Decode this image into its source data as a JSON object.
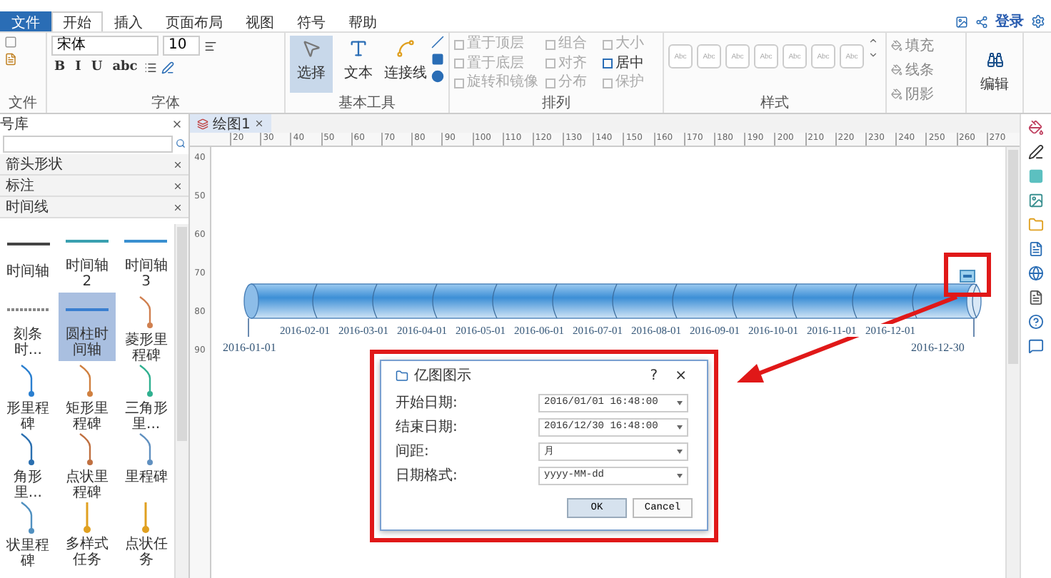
{
  "menu": [
    {
      "label": "文件",
      "kind": "file",
      "selected": false
    },
    {
      "label": "开始",
      "kind": "tab",
      "selected": true
    },
    {
      "label": "插入",
      "kind": "tab",
      "selected": false
    },
    {
      "label": "页面布局",
      "kind": "tab",
      "selected": false
    },
    {
      "label": "视图",
      "kind": "tab",
      "selected": false
    },
    {
      "label": "符号",
      "kind": "tab",
      "selected": false
    },
    {
      "label": "帮助",
      "kind": "tab",
      "selected": false
    }
  ],
  "account": {
    "login": "登录"
  },
  "ribbon": {
    "file_group": {
      "label": "文件"
    },
    "font_group": {
      "label": "字体",
      "font": "宋体",
      "size": "10",
      "buttons": [
        "B",
        "I",
        "U",
        "abc"
      ]
    },
    "tools_group": {
      "label": "基本工具",
      "tools": [
        {
          "label": "选择",
          "selected": true
        },
        {
          "label": "文本",
          "selected": false
        },
        {
          "label": "连接线",
          "selected": false
        }
      ]
    },
    "arrange_group": {
      "label": "排列",
      "items": [
        {
          "label": "置于顶层",
          "disabled": true
        },
        {
          "label": "组合",
          "disabled": true
        },
        {
          "label": "大小",
          "disabled": true
        },
        {
          "label": "置于底层",
          "disabled": true
        },
        {
          "label": "对齐",
          "disabled": true
        },
        {
          "label": "居中",
          "disabled": false
        },
        {
          "label": "旋转和镜像",
          "disabled": true
        },
        {
          "label": "分布",
          "disabled": true
        },
        {
          "label": "保护",
          "disabled": true
        }
      ]
    },
    "style_group": {
      "label": "样式",
      "samples": [
        "Abc",
        "Abc",
        "Abc",
        "Abc",
        "Abc",
        "Abc",
        "Abc"
      ]
    },
    "format_items": [
      "填充",
      "线条",
      "阴影"
    ],
    "edit": "编辑"
  },
  "library": {
    "title": "号库",
    "categories": [
      "箭头形状",
      "标注",
      "时间线"
    ],
    "shapes": [
      {
        "label": "时间轴",
        "kind": "line",
        "color": "#444444",
        "selected": false
      },
      {
        "label": "时间轴 2",
        "kind": "line",
        "color": "#3aa0b0",
        "selected": false
      },
      {
        "label": "时间轴 3",
        "kind": "line",
        "color": "#3a8fd0",
        "selected": false
      },
      {
        "label": "刻条时...",
        "kind": "dashed",
        "color": "#888888",
        "selected": false
      },
      {
        "label": "圆柱时间轴",
        "kind": "line",
        "color": "#3a7fd0",
        "selected": true
      },
      {
        "label": "菱形里程碑",
        "kind": "milestone",
        "color": "#d08050",
        "selected": false
      },
      {
        "label": "形里程碑",
        "kind": "milestone",
        "color": "#2a7fd0",
        "selected": false
      },
      {
        "label": "矩形里程碑",
        "kind": "milestone",
        "color": "#d08040",
        "selected": false
      },
      {
        "label": "三角形里...",
        "kind": "milestone",
        "color": "#30b090",
        "selected": false
      },
      {
        "label": "角形里...",
        "kind": "milestone",
        "color": "#2a6fb0",
        "selected": false
      },
      {
        "label": "点状里程碑",
        "kind": "milestone",
        "color": "#c07040",
        "selected": false
      },
      {
        "label": "里程碑",
        "kind": "milestone",
        "color": "#6090c0",
        "selected": false
      },
      {
        "label": "状里程碑",
        "kind": "milestone",
        "color": "#5090c0",
        "selected": false
      },
      {
        "label": "多样式任务",
        "kind": "task",
        "color": "#e0a020",
        "selected": false
      },
      {
        "label": "点状任务",
        "kind": "task",
        "color": "#e0a020",
        "selected": false
      }
    ]
  },
  "document_tab": {
    "label": "绘图1",
    "selected": true
  },
  "ruler": {
    "horizontal": [
      "20",
      "30",
      "40",
      "50",
      "60",
      "70",
      "80",
      "90",
      "100",
      "110",
      "120",
      "130",
      "140",
      "150",
      "160",
      "170",
      "180",
      "190",
      "200",
      "210",
      "220",
      "230",
      "240",
      "250",
      "260",
      "270"
    ],
    "vertical": [
      "40",
      "50",
      "60",
      "70",
      "80",
      "90"
    ]
  },
  "timeline": {
    "labels_top": [
      "2016-02-01",
      "2016-03-01",
      "2016-04-01",
      "2016-05-01",
      "2016-06-01",
      "2016-07-01",
      "2016-08-01",
      "2016-09-01",
      "2016-10-01",
      "2016-11-01",
      "2016-12-01"
    ],
    "start": "2016-01-01",
    "end": "2016-12-30"
  },
  "dialog": {
    "title": "亿图图示",
    "help": "?",
    "close": "×",
    "fields": [
      {
        "label": "开始日期:",
        "value": "2016/01/01 16:48:00"
      },
      {
        "label": "结束日期:",
        "value": "2016/12/30 16:48:00"
      },
      {
        "label": "间距:",
        "value": "月"
      },
      {
        "label": "日期格式:",
        "value": "yyyy-MM-dd"
      }
    ],
    "ok": "OK",
    "cancel": "Cancel"
  }
}
